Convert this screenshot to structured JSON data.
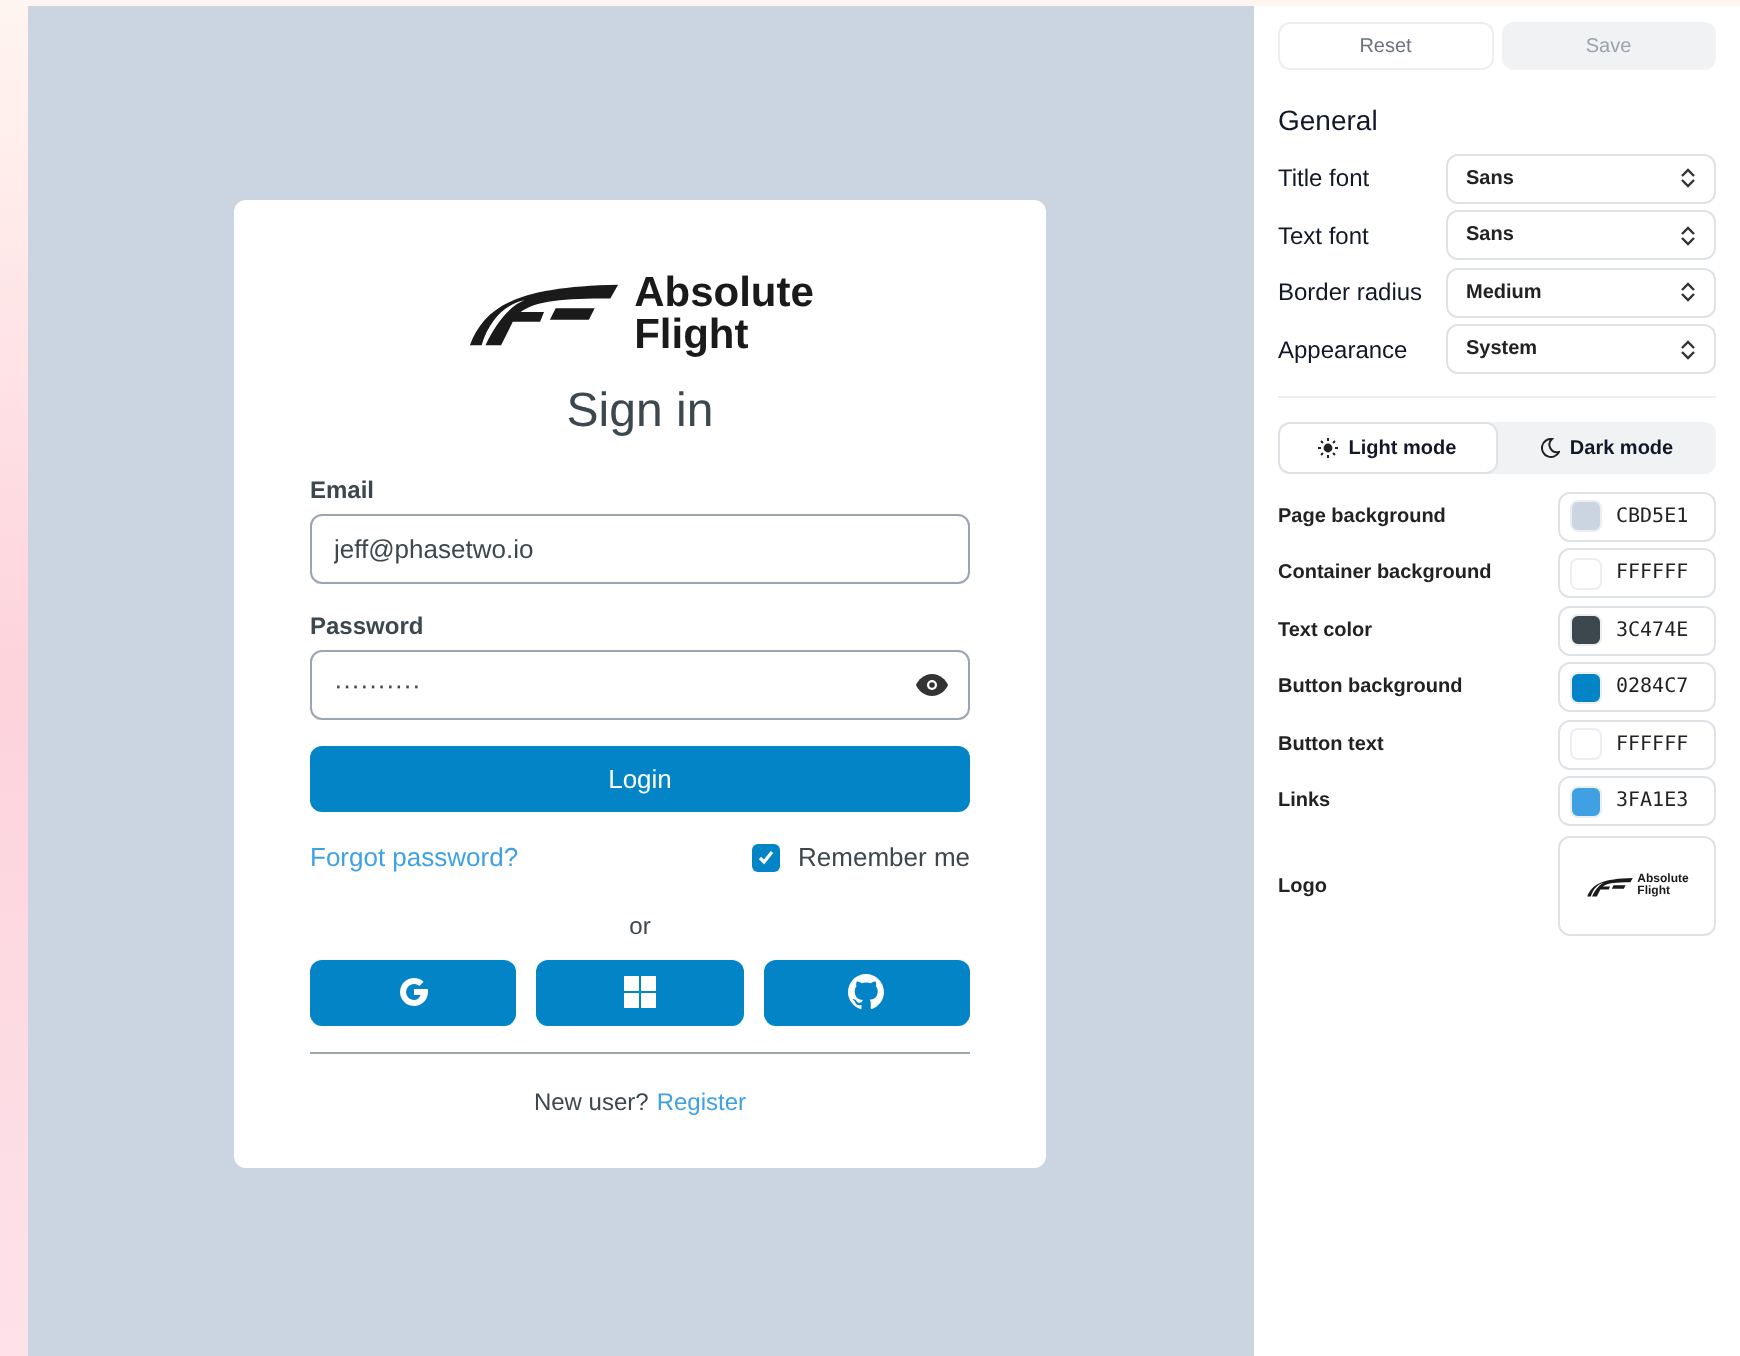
{
  "login": {
    "logo_text": [
      "Absolute",
      "Flight"
    ],
    "title": "Sign in",
    "email": {
      "label": "Email",
      "value": "jeff@phasetwo.io"
    },
    "password": {
      "label": "Password",
      "value": "··········"
    },
    "login_button": "Login",
    "forgot_link": "Forgot password?",
    "remember": {
      "label": "Remember me",
      "checked": true
    },
    "divider_text": "or",
    "social": [
      {
        "kind": "google"
      },
      {
        "kind": "windows"
      },
      {
        "kind": "github"
      }
    ],
    "register_prompt": "New user?",
    "register_link": "Register"
  },
  "panel": {
    "actions": [
      {
        "label": "Reset",
        "disabled": false
      },
      {
        "label": "Save",
        "disabled": true
      }
    ],
    "section": "General",
    "selects": [
      {
        "label": "Title font",
        "value": "Sans"
      },
      {
        "label": "Text font",
        "value": "Sans"
      },
      {
        "label": "Border radius",
        "value": "Medium"
      },
      {
        "label": "Appearance",
        "value": "System"
      }
    ],
    "modes": [
      {
        "label": "Light mode",
        "kind": "sun",
        "selected": true
      },
      {
        "label": "Dark mode",
        "kind": "moon",
        "selected": false
      }
    ],
    "colors": [
      {
        "label": "Page background",
        "value": "CBD5E1",
        "color": "#cbd5e1"
      },
      {
        "label": "Container background",
        "value": "FFFFFF",
        "color": "#ffffff"
      },
      {
        "label": "Text color",
        "value": "3C474E",
        "color": "#3c474e"
      },
      {
        "label": "Button background",
        "value": "0284C7",
        "color": "#0284c7"
      },
      {
        "label": "Button text",
        "value": "FFFFFF",
        "color": "#ffffff"
      },
      {
        "label": "Links",
        "value": "3FA1E3",
        "color": "#3fa1e3"
      }
    ],
    "logo_label": "Logo",
    "logo_thumbnail_text": [
      "Absolute",
      "Flight"
    ]
  }
}
